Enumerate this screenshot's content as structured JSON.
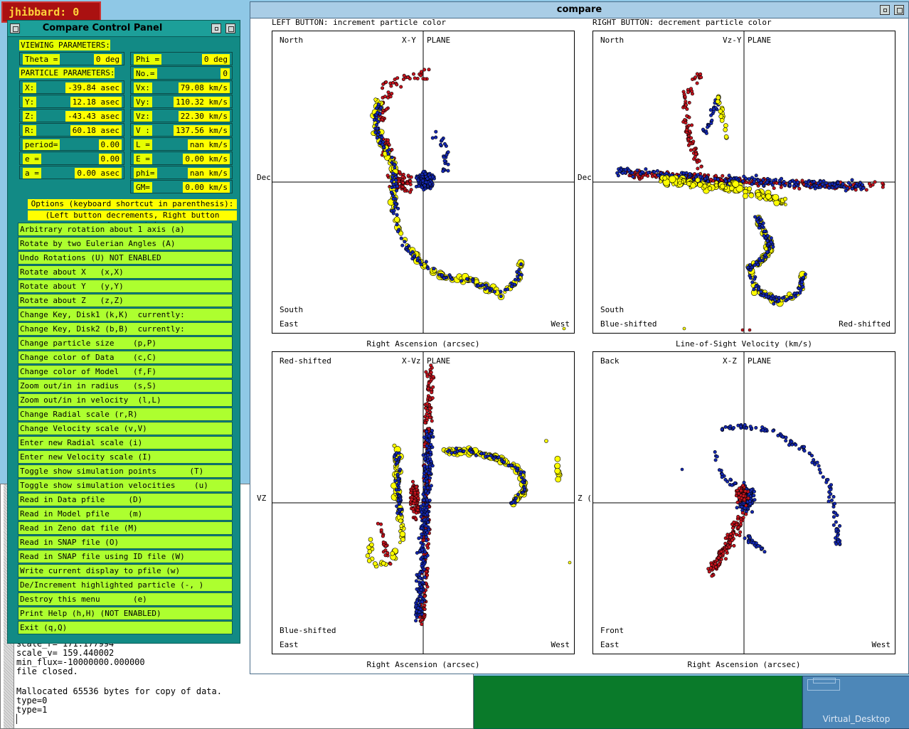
{
  "user_tag": "jhibbard: 0",
  "terminal": {
    "lines_top": [
      "scale_r= 171.177994",
      "scale_v= 159.440002",
      "min_flux=-10000000.000000",
      "file closed."
    ],
    "lines_bottom": [
      "Mallocated 65536 bytes for copy of data.",
      "type=0",
      "type=1"
    ],
    "cursor": "▏"
  },
  "pager": {
    "label": "Virtual_Desktop"
  },
  "control_panel": {
    "title": "Compare Control Panel",
    "viewing_header": "VIEWING PARAMETERS:",
    "particle_header": "PARTICLE PARAMETERS:",
    "theta": {
      "label": "Theta =",
      "value": "0 deg"
    },
    "phi": {
      "label": "Phi =",
      "value": "0 deg"
    },
    "no": {
      "label": "No.=",
      "value": "0"
    },
    "left_fields": [
      {
        "label": "X:",
        "value": "-39.84 asec"
      },
      {
        "label": "Y:",
        "value": "12.18 asec"
      },
      {
        "label": "Z:",
        "value": "-43.43 asec"
      },
      {
        "label": "R:",
        "value": "60.18 asec"
      },
      {
        "label": "period=",
        "value": "0.00"
      },
      {
        "label": "e =",
        "value": "0.00"
      },
      {
        "label": "a =",
        "value": "0.00 asec"
      }
    ],
    "right_fields": [
      {
        "label": "Vx:",
        "value": "79.08 km/s"
      },
      {
        "label": "Vy:",
        "value": "110.32 km/s"
      },
      {
        "label": "Vz:",
        "value": "22.30 km/s"
      },
      {
        "label": "V :",
        "value": "137.56 km/s"
      },
      {
        "label": "L =",
        "value": "nan km/s"
      },
      {
        "label": "E =",
        "value": "0.00 km/s"
      },
      {
        "label": "phi=",
        "value": "nan km/s"
      },
      {
        "label": "GM=",
        "value": "0.00 km/s"
      }
    ],
    "options_note1": "Options (keyboard shortcut in parenthesis):",
    "options_note2": "(Left button decrements, Right button increments)",
    "menu": [
      "Arbitrary rotation about 1 axis (a)",
      "Rotate by two Eulerian Angles (A)",
      "Undo Rotations (U) NOT ENABLED",
      "Rotate about X   (x,X)",
      "Rotate about Y   (y,Y)",
      "Rotate about Z   (z,Z)",
      "Change Key, Disk1 (k,K)  currently:",
      "Change Key, Disk2 (b,B)  currently:",
      "Change particle size    (p,P)",
      "Change color of Data    (c,C)",
      "Change color of Model   (f,F)",
      "Zoom out/in in radius   (s,S)",
      "Zoom out/in in velocity  (l,L)",
      "Change Radial scale (r,R)",
      "Change Velocity scale (v,V)",
      "Enter new Radial scale (i)",
      "Enter new Velocity scale (I)",
      "Toggle show simulation points       (T)",
      "Toggle show simulation velocities    (u)",
      "Read in Data pfile     (D)",
      "Read in Model pfile    (m)",
      "Read in Zeno dat file (M)",
      "Read in SNAP file (O)",
      "Read in SNAP file using ID file (W)",
      "Write current display to pfile (w)",
      "De/Increment highlighted particle (-, )",
      "Destroy this menu       (e)",
      "Print Help (h,H) (NOT ENABLED)",
      "Exit (q,Q)"
    ]
  },
  "compare": {
    "title": "compare",
    "left_instr": "LEFT BUTTON: increment particle color",
    "right_instr": "RIGHT BUTTON: decrement particle color",
    "colors": {
      "data": "#c8141e",
      "model_a": "#1428b4",
      "model_b": "#ffff00"
    },
    "plots": [
      {
        "id": "xy",
        "plane": "X-Y",
        "plane_suffix": "PLANE",
        "tl": "North",
        "bl1": "South",
        "bl2": "East",
        "br": "West",
        "xlabel": "Right Ascension (arcsec)",
        "side": "Dec"
      },
      {
        "id": "vzy",
        "plane": "Vz-Y",
        "plane_suffix": "PLANE",
        "tl": "North",
        "bl1": "South",
        "bl2": "Blue-shifted",
        "br": "Red-shifted",
        "xlabel": "Line-of-Sight Velocity (km/s)",
        "side": "Dec"
      },
      {
        "id": "xvz",
        "plane": "X-Vz",
        "plane_suffix": "PLANE",
        "tl": "Red-shifted",
        "bl1": "Blue-shifted",
        "bl2": "East",
        "br": "West",
        "xlabel": "Right Ascension (arcsec)",
        "side": "VZ"
      },
      {
        "id": "xz",
        "plane": "X-Z",
        "plane_suffix": "PLANE",
        "tl": "Back",
        "bl1": "Front",
        "bl2": "East",
        "br": "West",
        "xlabel": "Right Ascension (arcsec)",
        "side": "Z ("
      }
    ]
  }
}
